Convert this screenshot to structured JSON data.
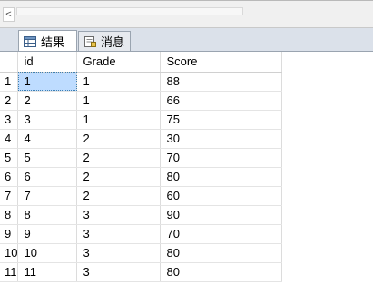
{
  "tabs": [
    {
      "label": "结果",
      "icon": "grid-icon",
      "active": true
    },
    {
      "label": "消息",
      "icon": "message-icon",
      "active": false
    }
  ],
  "scroll": {
    "arrow": "<"
  },
  "grid": {
    "columns": [
      "id",
      "Grade",
      "Score"
    ],
    "rows": [
      {
        "num": "1",
        "id": "1",
        "grade": "1",
        "score": "88"
      },
      {
        "num": "2",
        "id": "2",
        "grade": "1",
        "score": "66"
      },
      {
        "num": "3",
        "id": "3",
        "grade": "1",
        "score": "75"
      },
      {
        "num": "4",
        "id": "4",
        "grade": "2",
        "score": "30"
      },
      {
        "num": "5",
        "id": "5",
        "grade": "2",
        "score": "70"
      },
      {
        "num": "6",
        "id": "6",
        "grade": "2",
        "score": "80"
      },
      {
        "num": "7",
        "id": "7",
        "grade": "2",
        "score": "60"
      },
      {
        "num": "8",
        "id": "8",
        "grade": "3",
        "score": "90"
      },
      {
        "num": "9",
        "id": "9",
        "grade": "3",
        "score": "70"
      },
      {
        "num": "10",
        "id": "10",
        "grade": "3",
        "score": "80"
      },
      {
        "num": "11",
        "id": "11",
        "grade": "3",
        "score": "80"
      }
    ]
  },
  "colors": {
    "selection": "#bedcff",
    "tab_bar": "#dbe1ea"
  }
}
